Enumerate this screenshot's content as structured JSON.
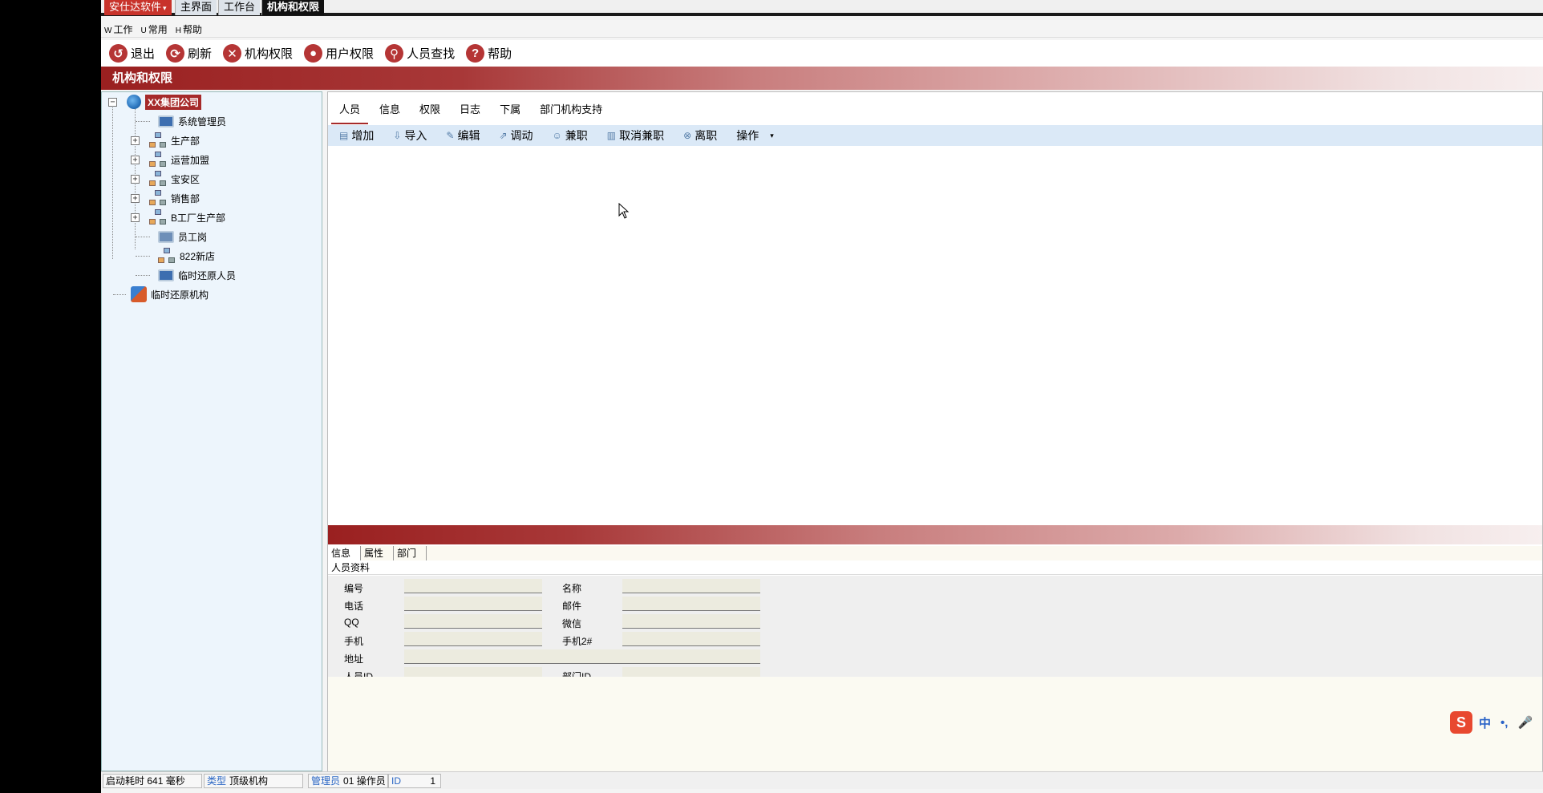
{
  "topbar": {
    "brand": "安仕达软件",
    "tabs": [
      "主界面",
      "工作台",
      "机构和权限"
    ]
  },
  "menubar": {
    "items": [
      {
        "key": "W",
        "label": "工作"
      },
      {
        "key": "U",
        "label": "常用"
      },
      {
        "key": "H",
        "label": "帮助"
      }
    ]
  },
  "toolbar": {
    "exit": "退出",
    "refresh": "刷新",
    "org_perm": "机构权限",
    "user_perm": "用户权限",
    "find_person": "人员查找",
    "help": "帮助"
  },
  "banner": {
    "title": "机构和权限"
  },
  "tree": {
    "root": "XX集团公司",
    "children": [
      "系统管理员",
      "生产部",
      "运营加盟",
      "宝安区",
      "销售部",
      "B工厂生产部",
      "员工岗",
      "822新店",
      "临时还原人员"
    ],
    "other_root": "临时还原机构"
  },
  "tabs": [
    "人员",
    "信息",
    "权限",
    "日志",
    "下属",
    "部门机构支持"
  ],
  "subtoolbar": {
    "add": "增加",
    "import": "导入",
    "edit": "编辑",
    "transfer": "调动",
    "concurrent": "兼职",
    "cancel_concurrent": "取消兼职",
    "leave": "离职",
    "operate": "操作"
  },
  "lower": {
    "tabs": [
      "信息",
      "属性",
      "部门"
    ],
    "section_title": "人员资料",
    "fields": {
      "code": "编号",
      "name": "名称",
      "phone": "电话",
      "email": "邮件",
      "qq": "QQ",
      "wechat": "微信",
      "mobile": "手机",
      "mobile2": "手机2#",
      "address": "地址",
      "person_id": "人员ID",
      "dept_id": "部门ID"
    }
  },
  "ime": {
    "logo": "S",
    "lang": "中",
    "punct": "•,",
    "mic": "🎤"
  },
  "status": {
    "startup_label": "启动耗时",
    "startup_value": "641 毫秒",
    "type_label": "类型",
    "type_value": "顶级机构",
    "admin_label": "管理员",
    "admin_value": "01",
    "operator_label": "操作员",
    "id_label": "ID",
    "id_value": "1"
  }
}
